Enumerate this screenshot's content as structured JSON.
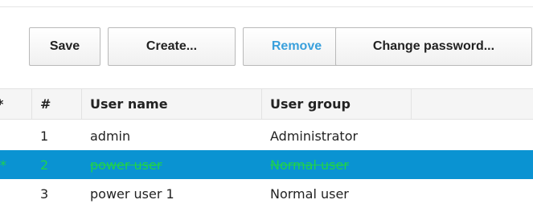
{
  "toolbar": {
    "save_label": "Save",
    "create_label": "Create...",
    "remove_label": "Remove",
    "change_password_label": "Change password..."
  },
  "grid": {
    "columns": [
      "*",
      "#",
      "User name",
      "User group"
    ],
    "rows": [
      {
        "mark": "",
        "num": "1",
        "name": "admin",
        "group": "Administrator",
        "selected": false,
        "deleted": false
      },
      {
        "mark": "*",
        "num": "2",
        "name": "power user",
        "group": "Normal user",
        "selected": true,
        "deleted": true
      },
      {
        "mark": "",
        "num": "3",
        "name": "power user 1",
        "group": "Normal user",
        "selected": false,
        "deleted": false
      }
    ]
  },
  "colors": {
    "selection_background": "#0a93d2",
    "deleted_text": "#1fd34a",
    "remove_button_text": "#3aa0dc"
  }
}
